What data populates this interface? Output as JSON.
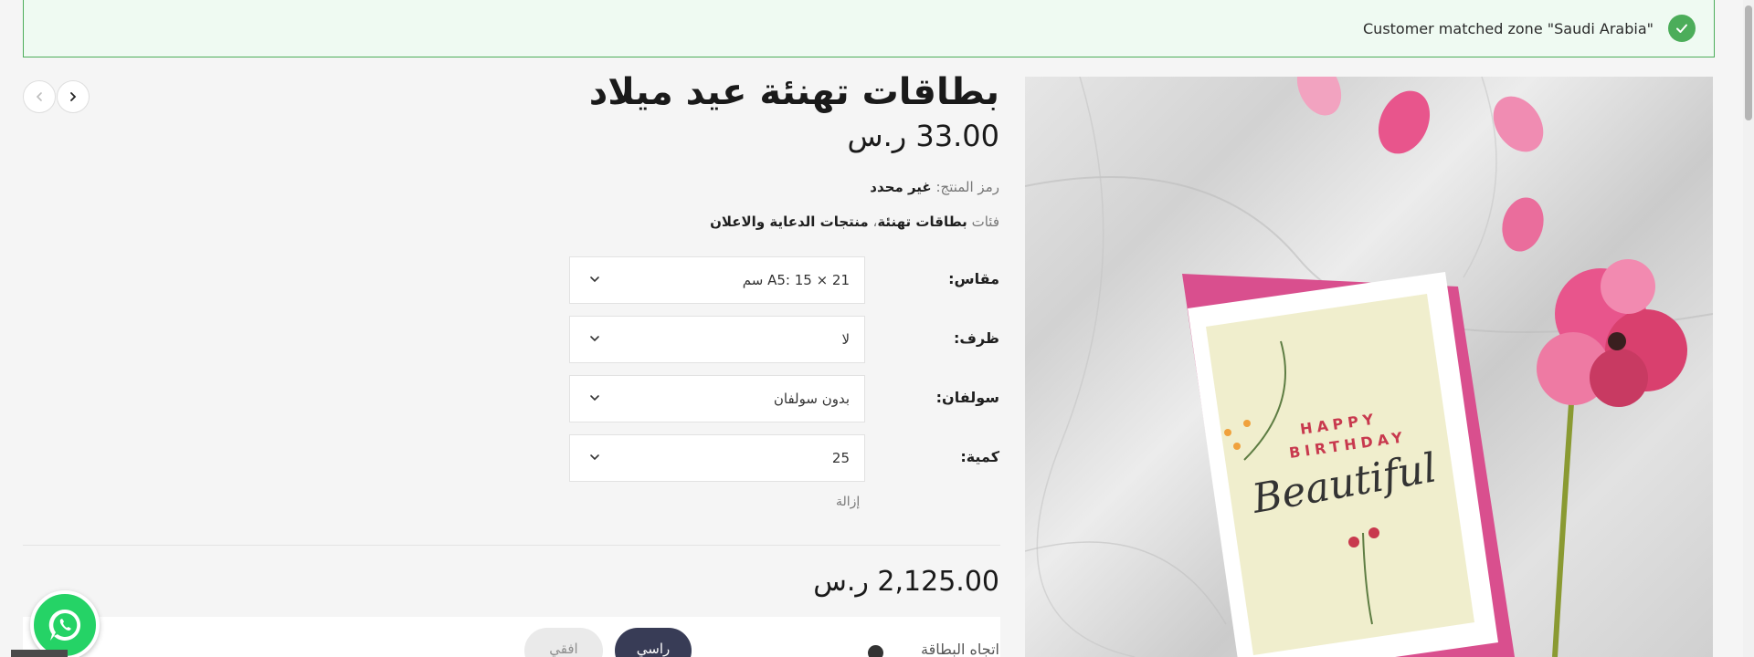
{
  "notice": {
    "text": "Customer matched zone \"Saudi Arabia\""
  },
  "product": {
    "title": "بطاقات تهنئة عيد ميلاد",
    "price": "33.00 ر.س",
    "sku_label": "رمز المنتج:",
    "sku_value": "غير محدد",
    "categories_label": "فئات",
    "categories": [
      "بطاقات تهنئة",
      "منتجات الدعاية والاعلان"
    ],
    "image": {
      "card_text_line1": "HAPPY",
      "card_text_line2": "BIRTHDAY",
      "card_text_script": "Beautiful"
    }
  },
  "variations": [
    {
      "label": "مقاس:",
      "value": "A5: 15 × 21 سم"
    },
    {
      "label": "ظرف:",
      "value": "لا"
    },
    {
      "label": "سولفان:",
      "value": "بدون سولفان"
    },
    {
      "label": "كمية:",
      "value": "25"
    }
  ],
  "clear_label": "إزالة",
  "total_price": "2,125.00 ر.س",
  "orientation": {
    "label": "اتجاه البطاقة",
    "options": [
      "راسي",
      "افقي"
    ],
    "selected": "راسي"
  },
  "colors": {
    "success": "#4cad5a",
    "accent": "#383c56",
    "whatsapp": "#25d366",
    "envelope": "#d94f8e",
    "petal": "#e8558c"
  }
}
